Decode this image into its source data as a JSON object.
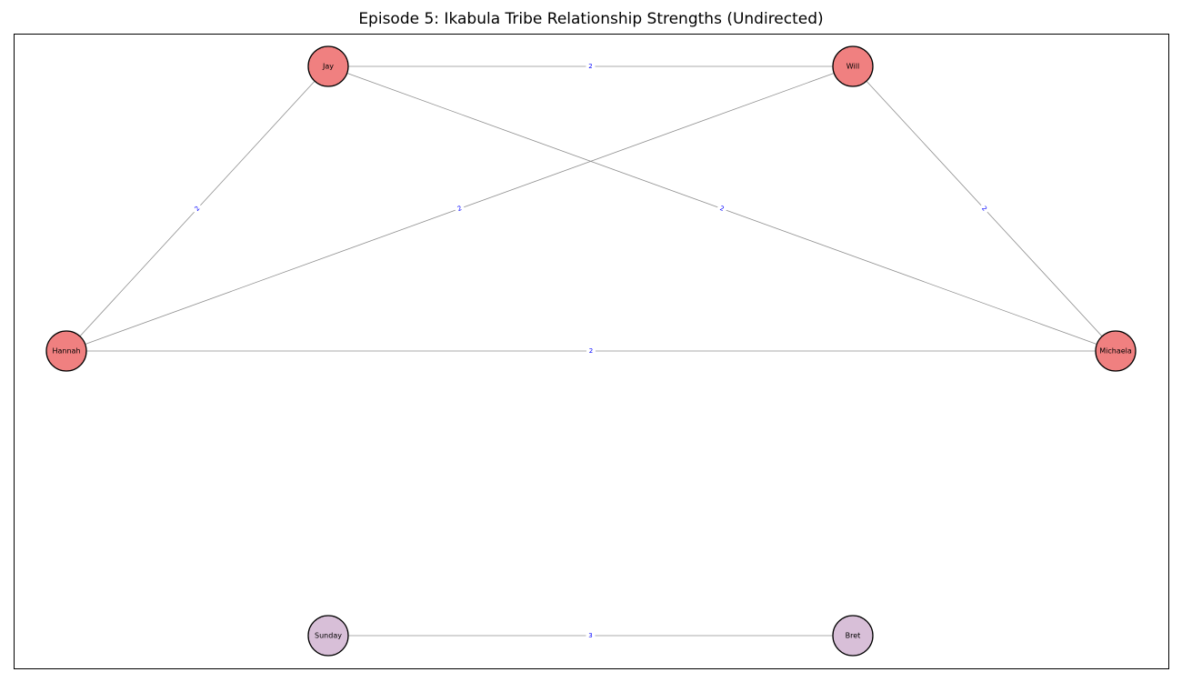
{
  "title": "Episode 5: Ikabula Tribe Relationship Strengths (Undirected)",
  "colors": {
    "group_a": "#f08080",
    "group_b": "#d8bfd8",
    "edge": "#8f8f8f",
    "edge_label": "#0000ff"
  },
  "nodes": [
    {
      "id": "Jay",
      "label": "Jay",
      "group": "group_a"
    },
    {
      "id": "Will",
      "label": "Will",
      "group": "group_a"
    },
    {
      "id": "Hannah",
      "label": "Hannah",
      "group": "group_a"
    },
    {
      "id": "Michaela",
      "label": "Michaela",
      "group": "group_a"
    },
    {
      "id": "Sunday",
      "label": "Sunday",
      "group": "group_b"
    },
    {
      "id": "Bret",
      "label": "Bret",
      "group": "group_b"
    }
  ],
  "edges": [
    {
      "source": "Jay",
      "target": "Will",
      "weight": "2"
    },
    {
      "source": "Jay",
      "target": "Hannah",
      "weight": "2"
    },
    {
      "source": "Jay",
      "target": "Michaela",
      "weight": "2"
    },
    {
      "source": "Will",
      "target": "Hannah",
      "weight": "2"
    },
    {
      "source": "Will",
      "target": "Michaela",
      "weight": "2"
    },
    {
      "source": "Hannah",
      "target": "Michaela",
      "weight": "2"
    },
    {
      "source": "Sunday",
      "target": "Bret",
      "weight": "3"
    }
  ]
}
